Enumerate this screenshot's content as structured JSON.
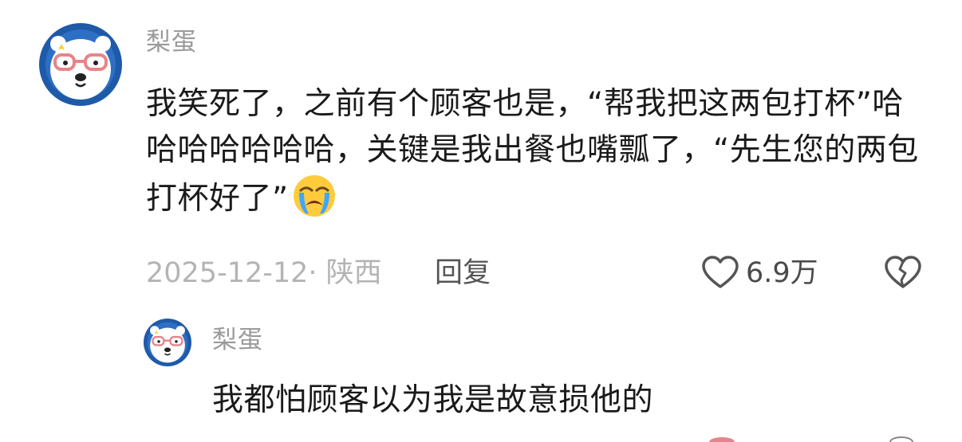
{
  "comment": {
    "avatar": "polar-bear-avatar",
    "username": "梨蛋",
    "text": "我笑死了，之前有个顾客也是，“帮我把这两包打杯”哈哈哈哈哈哈哈，关键是我出餐也嘴瓢了，“先生您的两包打杯好了”",
    "emoji": "loudly-crying-face-emoji",
    "date_location": "2025-12-12· 陕西",
    "reply_label": "回复",
    "like_count": "6.9万",
    "icons": {
      "like": "heart-outline-icon",
      "dislike": "broken-heart-outline-icon"
    }
  },
  "reply": {
    "avatar": "polar-bear-avatar",
    "username": "梨蛋",
    "text": "我都怕顾客以为我是故意损他的"
  },
  "colors": {
    "avatar_ring": "#1f5aa8",
    "glasses": "#e8838a",
    "text": "#1a1a1a",
    "muted": "#9a9a9a"
  }
}
